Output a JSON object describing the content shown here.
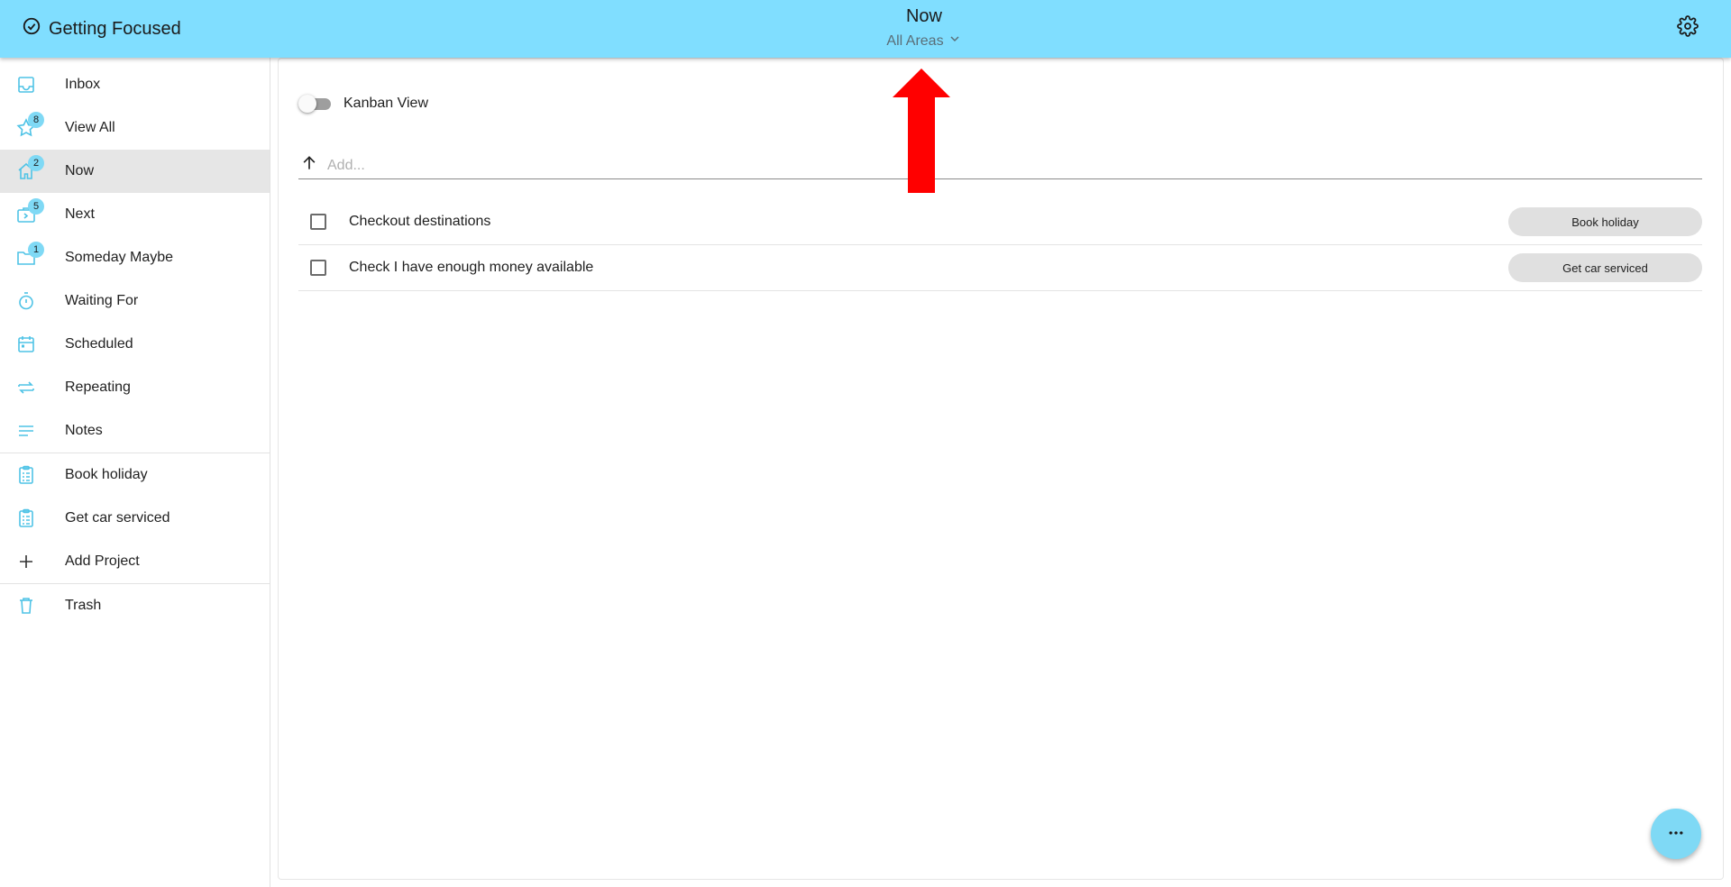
{
  "header": {
    "brand": "Getting Focused",
    "title": "Now",
    "area_selector": "All Areas",
    "brand_icon": "check-circle-icon",
    "settings_icon": "gear-icon",
    "color": "#80deff"
  },
  "sidebar": {
    "items": [
      {
        "label": "Inbox",
        "icon": "inbox-icon"
      },
      {
        "label": "View All",
        "icon": "star-icon",
        "badge": "8"
      },
      {
        "label": "Now",
        "icon": "home-icon",
        "badge": "2",
        "active": true
      },
      {
        "label": "Next",
        "icon": "next-icon",
        "badge": "5"
      },
      {
        "label": "Someday Maybe",
        "icon": "folder-icon",
        "badge": "1"
      },
      {
        "label": "Waiting For",
        "icon": "timer-icon"
      },
      {
        "label": "Scheduled",
        "icon": "calendar-icon"
      },
      {
        "label": "Repeating",
        "icon": "repeat-icon"
      },
      {
        "label": "Notes",
        "icon": "notes-icon"
      }
    ],
    "projects": [
      {
        "label": "Book holiday",
        "icon": "clipboard-icon"
      },
      {
        "label": "Get car serviced",
        "icon": "clipboard-icon"
      },
      {
        "label": "Add Project",
        "icon": "plus-icon"
      }
    ],
    "trash": {
      "label": "Trash",
      "icon": "trash-icon"
    },
    "accent": "#4fc3e6"
  },
  "main": {
    "kanban_label": "Kanban View",
    "kanban_enabled": false,
    "add_placeholder": "Add...",
    "tasks": [
      {
        "text": "Checkout destinations",
        "project": "Book holiday",
        "done": false
      },
      {
        "text": "Check I have enough money available",
        "project": "Get car serviced",
        "done": false
      }
    ]
  },
  "fab": {
    "icon": "more-horizontal-icon"
  },
  "annotation": {
    "icon": "red-arrow-up-icon",
    "color": "#ff0000"
  }
}
